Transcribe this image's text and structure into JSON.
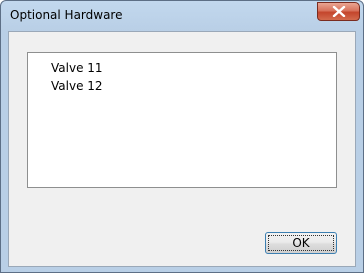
{
  "window": {
    "title": "Optional Hardware"
  },
  "list": {
    "items": [
      "Valve 11",
      "Valve 12"
    ]
  },
  "buttons": {
    "ok_label": "OK"
  },
  "icons": {
    "close": "close-icon"
  },
  "colors": {
    "title_bar": "#b9cfe6",
    "close_button": "#c4452c",
    "button_border": "#3c7fb1",
    "client_background": "#f0f0f0"
  }
}
